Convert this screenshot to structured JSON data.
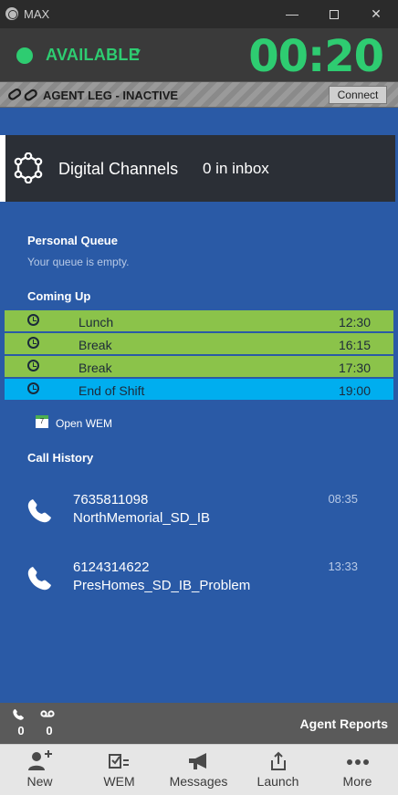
{
  "window": {
    "title": "MAX"
  },
  "status": {
    "label": "AVAILABLE",
    "timer": "00:20",
    "color": "#2ecc71"
  },
  "agent_leg": {
    "label": "AGENT LEG - INACTIVE",
    "connect_label": "Connect"
  },
  "digital_channels": {
    "title": "Digital Channels",
    "inbox": "0 in inbox"
  },
  "personal_queue": {
    "title": "Personal Queue",
    "empty_text": "Your queue is empty."
  },
  "coming_up": {
    "title": "Coming Up",
    "items": [
      {
        "name": "Lunch",
        "time": "12:30",
        "color": "#8bc34a"
      },
      {
        "name": "Break",
        "time": "16:15",
        "color": "#8bc34a"
      },
      {
        "name": "Break",
        "time": "17:30",
        "color": "#8bc34a"
      },
      {
        "name": "End of Shift",
        "time": "19:00",
        "color": "#00aeef"
      }
    ]
  },
  "open_wem": {
    "label": "Open WEM",
    "calendar_day": "7"
  },
  "call_history": {
    "title": "Call History",
    "calls": [
      {
        "number": "7635811098",
        "queue": "NorthMemorial_SD_IB",
        "time": "08:35"
      },
      {
        "number": "6124314622",
        "queue": "PresHomes_SD_IB_Problem",
        "time": "13:33"
      }
    ]
  },
  "bottom": {
    "calls_count": "0",
    "voicemail_count": "0",
    "agent_reports": "Agent Reports"
  },
  "nav": {
    "items": [
      {
        "label": "New",
        "icon": "add-user-icon"
      },
      {
        "label": "WEM",
        "icon": "checklist-icon"
      },
      {
        "label": "Messages",
        "icon": "megaphone-icon"
      },
      {
        "label": "Launch",
        "icon": "share-icon"
      },
      {
        "label": "More",
        "icon": "ellipsis-icon"
      }
    ]
  }
}
